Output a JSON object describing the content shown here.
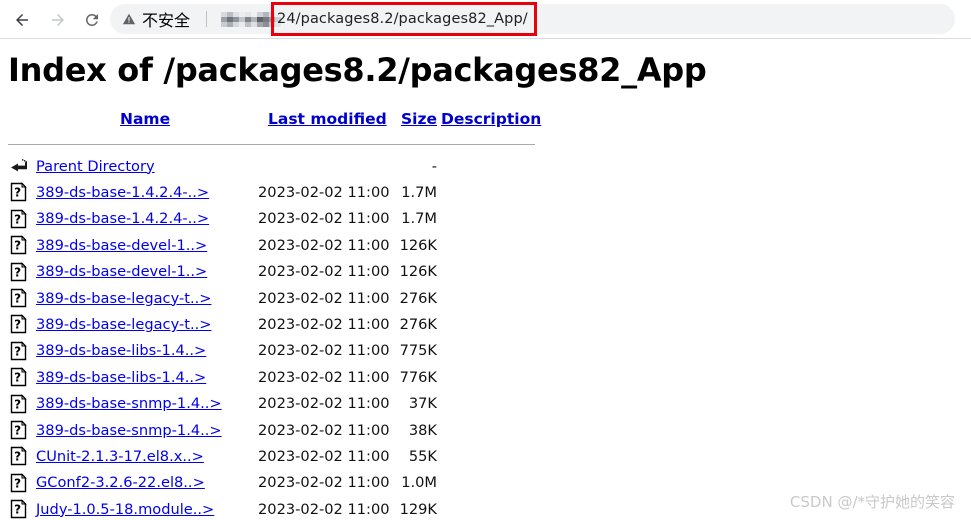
{
  "browser": {
    "back_icon": "arrow-left-icon",
    "forward_icon": "arrow-right-icon",
    "reload_icon": "reload-icon",
    "security": {
      "icon": "warning-triangle-icon",
      "label": "不安全"
    },
    "url": {
      "redacted_prefix_note": "pixelated-host",
      "visible_text": "24/packages8.2/packages82_App/"
    },
    "annotation": {
      "shape": "rectangle",
      "color": "#e8000d"
    }
  },
  "page": {
    "title": "Index of /packages8.2/packages82_App",
    "headers": {
      "name": "Name",
      "last_modified": "Last modified",
      "size": "Size",
      "description": "Description"
    },
    "rows": [
      {
        "icon": "parent-directory-icon",
        "name": "Parent Directory",
        "date": "",
        "size": "-"
      },
      {
        "icon": "unknown-file-icon",
        "name": "389-ds-base-1.4.2.4-..>",
        "date": "2023-02-02 11:00",
        "size": "1.7M"
      },
      {
        "icon": "unknown-file-icon",
        "name": "389-ds-base-1.4.2.4-..>",
        "date": "2023-02-02 11:00",
        "size": "1.7M"
      },
      {
        "icon": "unknown-file-icon",
        "name": "389-ds-base-devel-1..>",
        "date": "2023-02-02 11:00",
        "size": "126K"
      },
      {
        "icon": "unknown-file-icon",
        "name": "389-ds-base-devel-1..>",
        "date": "2023-02-02 11:00",
        "size": "126K"
      },
      {
        "icon": "unknown-file-icon",
        "name": "389-ds-base-legacy-t..>",
        "date": "2023-02-02 11:00",
        "size": "276K"
      },
      {
        "icon": "unknown-file-icon",
        "name": "389-ds-base-legacy-t..>",
        "date": "2023-02-02 11:00",
        "size": "276K"
      },
      {
        "icon": "unknown-file-icon",
        "name": "389-ds-base-libs-1.4..>",
        "date": "2023-02-02 11:00",
        "size": "775K"
      },
      {
        "icon": "unknown-file-icon",
        "name": "389-ds-base-libs-1.4..>",
        "date": "2023-02-02 11:00",
        "size": "776K"
      },
      {
        "icon": "unknown-file-icon",
        "name": "389-ds-base-snmp-1.4..>",
        "date": "2023-02-02 11:00",
        "size": "37K"
      },
      {
        "icon": "unknown-file-icon",
        "name": "389-ds-base-snmp-1.4..>",
        "date": "2023-02-02 11:00",
        "size": "38K"
      },
      {
        "icon": "unknown-file-icon",
        "name": "CUnit-2.1.3-17.el8.x..>",
        "date": "2023-02-02 11:00",
        "size": "55K"
      },
      {
        "icon": "unknown-file-icon",
        "name": "GConf2-3.2.6-22.el8..>",
        "date": "2023-02-02 11:00",
        "size": "1.0M"
      },
      {
        "icon": "unknown-file-icon",
        "name": "Judy-1.0.5-18.module..>",
        "date": "2023-02-02 11:00",
        "size": "129K"
      }
    ]
  },
  "watermark": {
    "text": "CSDN @/*守护她的笑容"
  }
}
